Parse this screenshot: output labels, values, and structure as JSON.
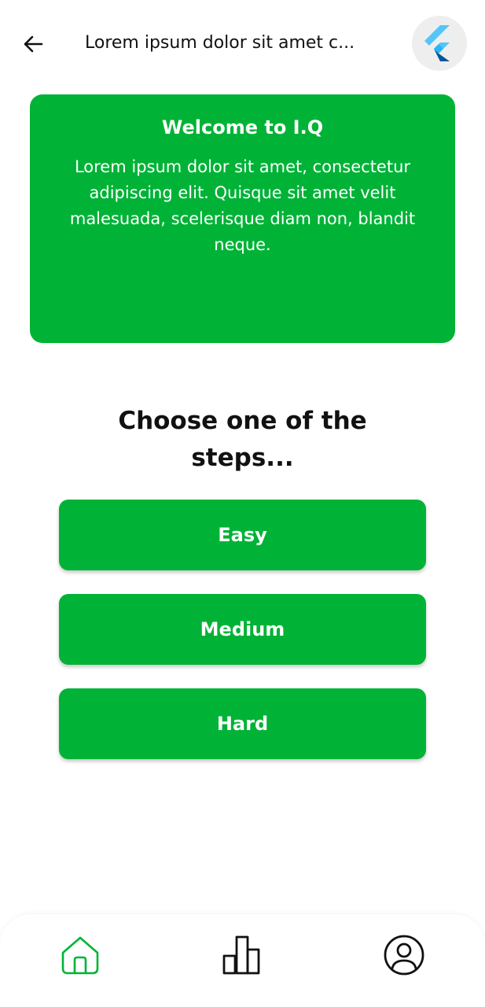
{
  "appbar": {
    "title": "Lorem ipsum dolor sit amet c...",
    "back_icon": "arrow-left-icon",
    "avatar_icon": "flutter-logo-icon"
  },
  "welcome": {
    "title": "Welcome to I.Q",
    "body": "Lorem ipsum dolor sit amet, consectetur adipiscing elit. Quisque sit amet velit malesuada, scelerisque diam non, blandit neque."
  },
  "steps": {
    "heading": "Choose one of the steps...",
    "options": [
      {
        "label": "Easy"
      },
      {
        "label": "Medium"
      },
      {
        "label": "Hard"
      }
    ]
  },
  "bottom_nav": {
    "items": [
      {
        "icon": "home-icon",
        "active": true
      },
      {
        "icon": "bar-chart-icon",
        "active": false
      },
      {
        "icon": "profile-icon",
        "active": false
      }
    ]
  },
  "colors": {
    "primary": "#00b336",
    "text": "#111111",
    "background": "#ffffff"
  }
}
